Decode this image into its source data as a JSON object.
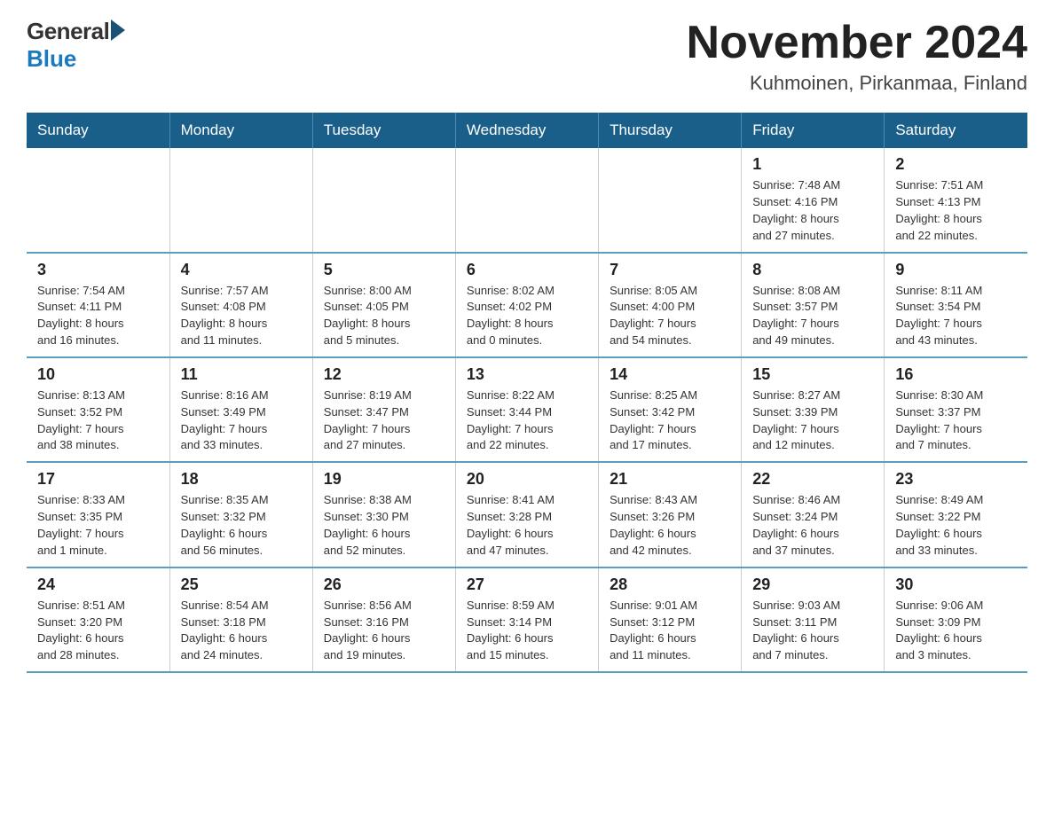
{
  "header": {
    "logo_general": "General",
    "logo_blue": "Blue",
    "month_title": "November 2024",
    "location": "Kuhmoinen, Pirkanmaa, Finland"
  },
  "weekdays": [
    "Sunday",
    "Monday",
    "Tuesday",
    "Wednesday",
    "Thursday",
    "Friday",
    "Saturday"
  ],
  "weeks": [
    [
      {
        "day": "",
        "info": ""
      },
      {
        "day": "",
        "info": ""
      },
      {
        "day": "",
        "info": ""
      },
      {
        "day": "",
        "info": ""
      },
      {
        "day": "",
        "info": ""
      },
      {
        "day": "1",
        "info": "Sunrise: 7:48 AM\nSunset: 4:16 PM\nDaylight: 8 hours\nand 27 minutes."
      },
      {
        "day": "2",
        "info": "Sunrise: 7:51 AM\nSunset: 4:13 PM\nDaylight: 8 hours\nand 22 minutes."
      }
    ],
    [
      {
        "day": "3",
        "info": "Sunrise: 7:54 AM\nSunset: 4:11 PM\nDaylight: 8 hours\nand 16 minutes."
      },
      {
        "day": "4",
        "info": "Sunrise: 7:57 AM\nSunset: 4:08 PM\nDaylight: 8 hours\nand 11 minutes."
      },
      {
        "day": "5",
        "info": "Sunrise: 8:00 AM\nSunset: 4:05 PM\nDaylight: 8 hours\nand 5 minutes."
      },
      {
        "day": "6",
        "info": "Sunrise: 8:02 AM\nSunset: 4:02 PM\nDaylight: 8 hours\nand 0 minutes."
      },
      {
        "day": "7",
        "info": "Sunrise: 8:05 AM\nSunset: 4:00 PM\nDaylight: 7 hours\nand 54 minutes."
      },
      {
        "day": "8",
        "info": "Sunrise: 8:08 AM\nSunset: 3:57 PM\nDaylight: 7 hours\nand 49 minutes."
      },
      {
        "day": "9",
        "info": "Sunrise: 8:11 AM\nSunset: 3:54 PM\nDaylight: 7 hours\nand 43 minutes."
      }
    ],
    [
      {
        "day": "10",
        "info": "Sunrise: 8:13 AM\nSunset: 3:52 PM\nDaylight: 7 hours\nand 38 minutes."
      },
      {
        "day": "11",
        "info": "Sunrise: 8:16 AM\nSunset: 3:49 PM\nDaylight: 7 hours\nand 33 minutes."
      },
      {
        "day": "12",
        "info": "Sunrise: 8:19 AM\nSunset: 3:47 PM\nDaylight: 7 hours\nand 27 minutes."
      },
      {
        "day": "13",
        "info": "Sunrise: 8:22 AM\nSunset: 3:44 PM\nDaylight: 7 hours\nand 22 minutes."
      },
      {
        "day": "14",
        "info": "Sunrise: 8:25 AM\nSunset: 3:42 PM\nDaylight: 7 hours\nand 17 minutes."
      },
      {
        "day": "15",
        "info": "Sunrise: 8:27 AM\nSunset: 3:39 PM\nDaylight: 7 hours\nand 12 minutes."
      },
      {
        "day": "16",
        "info": "Sunrise: 8:30 AM\nSunset: 3:37 PM\nDaylight: 7 hours\nand 7 minutes."
      }
    ],
    [
      {
        "day": "17",
        "info": "Sunrise: 8:33 AM\nSunset: 3:35 PM\nDaylight: 7 hours\nand 1 minute."
      },
      {
        "day": "18",
        "info": "Sunrise: 8:35 AM\nSunset: 3:32 PM\nDaylight: 6 hours\nand 56 minutes."
      },
      {
        "day": "19",
        "info": "Sunrise: 8:38 AM\nSunset: 3:30 PM\nDaylight: 6 hours\nand 52 minutes."
      },
      {
        "day": "20",
        "info": "Sunrise: 8:41 AM\nSunset: 3:28 PM\nDaylight: 6 hours\nand 47 minutes."
      },
      {
        "day": "21",
        "info": "Sunrise: 8:43 AM\nSunset: 3:26 PM\nDaylight: 6 hours\nand 42 minutes."
      },
      {
        "day": "22",
        "info": "Sunrise: 8:46 AM\nSunset: 3:24 PM\nDaylight: 6 hours\nand 37 minutes."
      },
      {
        "day": "23",
        "info": "Sunrise: 8:49 AM\nSunset: 3:22 PM\nDaylight: 6 hours\nand 33 minutes."
      }
    ],
    [
      {
        "day": "24",
        "info": "Sunrise: 8:51 AM\nSunset: 3:20 PM\nDaylight: 6 hours\nand 28 minutes."
      },
      {
        "day": "25",
        "info": "Sunrise: 8:54 AM\nSunset: 3:18 PM\nDaylight: 6 hours\nand 24 minutes."
      },
      {
        "day": "26",
        "info": "Sunrise: 8:56 AM\nSunset: 3:16 PM\nDaylight: 6 hours\nand 19 minutes."
      },
      {
        "day": "27",
        "info": "Sunrise: 8:59 AM\nSunset: 3:14 PM\nDaylight: 6 hours\nand 15 minutes."
      },
      {
        "day": "28",
        "info": "Sunrise: 9:01 AM\nSunset: 3:12 PM\nDaylight: 6 hours\nand 11 minutes."
      },
      {
        "day": "29",
        "info": "Sunrise: 9:03 AM\nSunset: 3:11 PM\nDaylight: 6 hours\nand 7 minutes."
      },
      {
        "day": "30",
        "info": "Sunrise: 9:06 AM\nSunset: 3:09 PM\nDaylight: 6 hours\nand 3 minutes."
      }
    ]
  ]
}
